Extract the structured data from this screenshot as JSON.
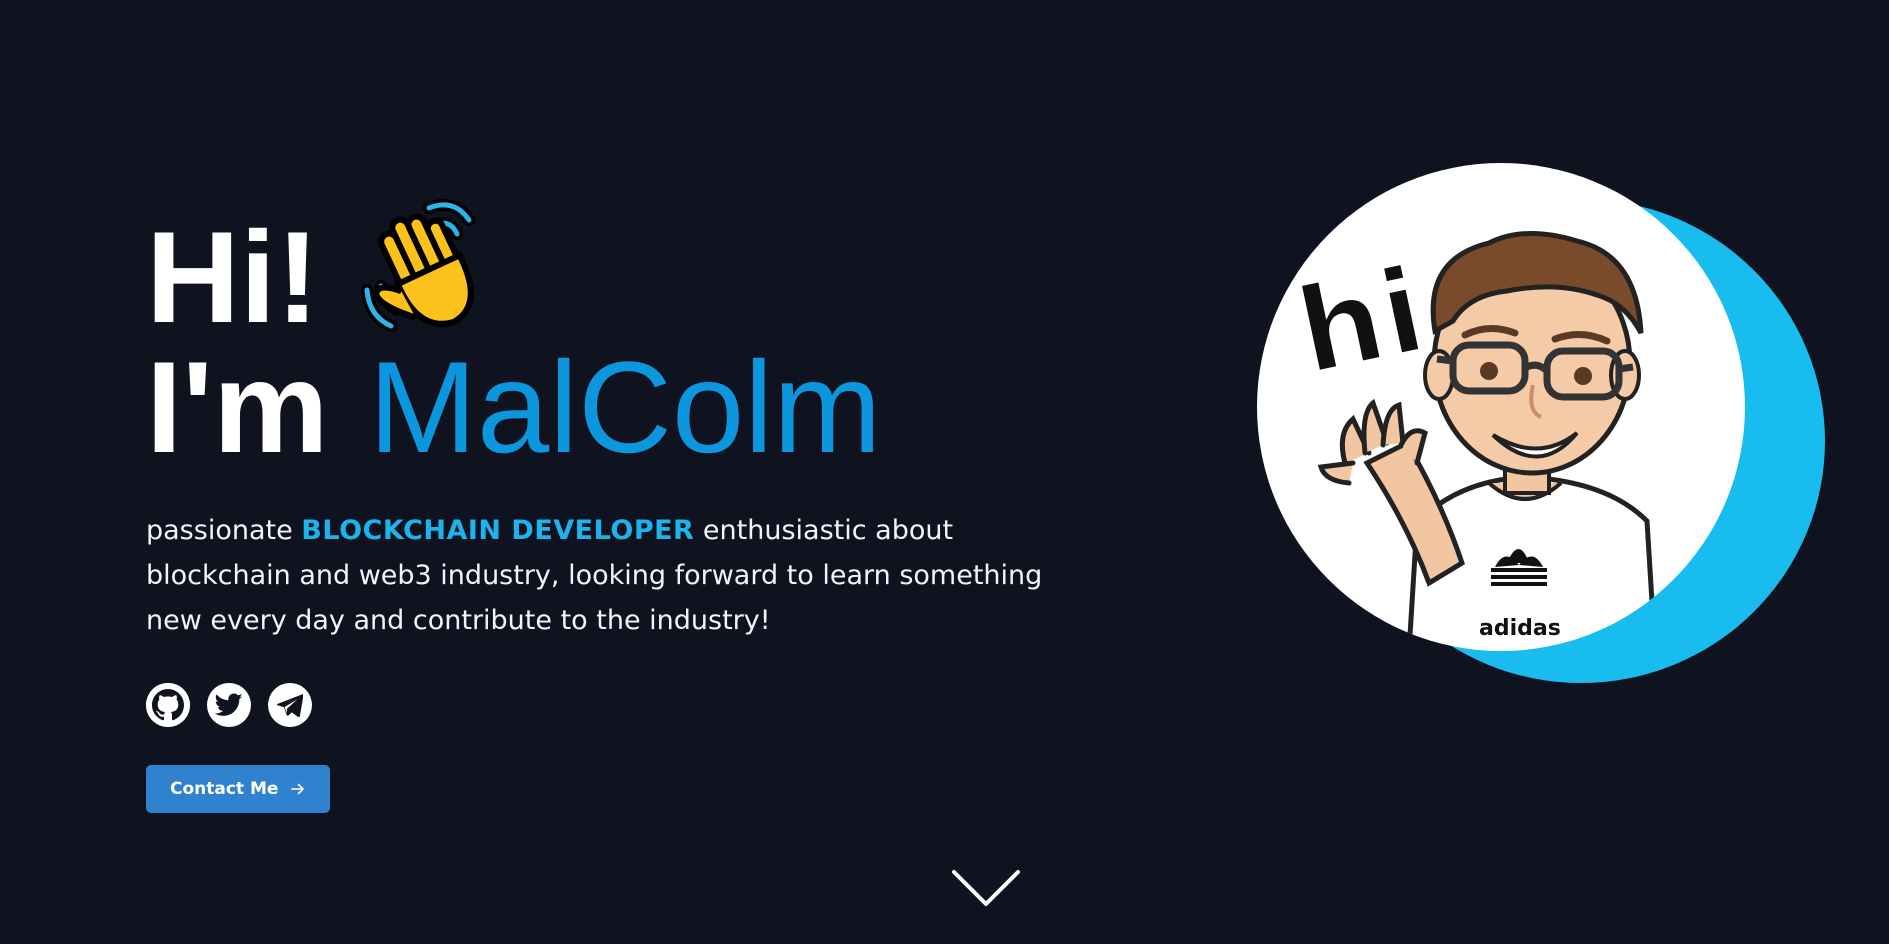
{
  "hero": {
    "greeting": "Hi!",
    "intro": "I'm",
    "name": "MalColm",
    "tagline_prefix": "passionate ",
    "tagline_highlight": "BLOCKCHAIN DEVELOPER",
    "tagline_suffix": " enthusiastic about blockchain and web3 industry, looking forward to learn something new every day and contribute to the industry!"
  },
  "socials": [
    {
      "name": "GitHub",
      "icon": "github-icon"
    },
    {
      "name": "Twitter",
      "icon": "twitter-icon"
    },
    {
      "name": "Telegram",
      "icon": "telegram-icon"
    }
  ],
  "contact": {
    "label": "Contact Me",
    "icon": "arrow-right-icon"
  },
  "avatar": {
    "speech_text": "hi",
    "shirt_text": "adidas"
  },
  "scroll": {
    "icon": "chevron-down-icon"
  },
  "colors": {
    "background": "#0f1320",
    "accent": "#0b96de",
    "highlight": "#1bb4ec",
    "button": "#3182ce",
    "avatar_shadow": "#19bcee"
  }
}
